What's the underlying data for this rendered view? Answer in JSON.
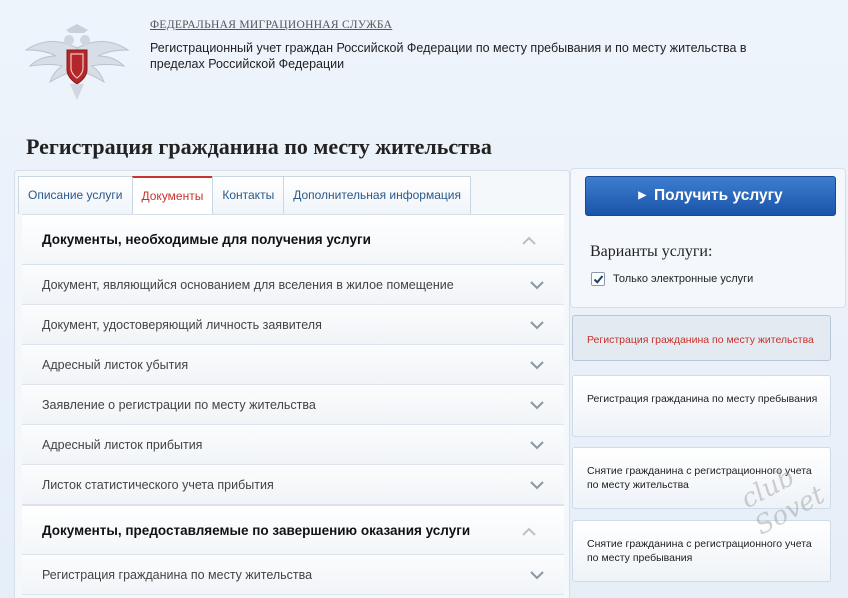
{
  "header": {
    "agency_name": "ФЕДЕРАЛЬНАЯ МИГРАЦИОННАЯ СЛУЖБА",
    "agency_description": "Регистрационный учет граждан Российской Федерации по месту пребывания и по месту жительства в пределах Российской Федерации",
    "emblem_icon": "double-headed-eagle-emblem"
  },
  "page_title": "Регистрация гражданина по месту жительства",
  "tabs": [
    {
      "label": "Описание услуги",
      "active": false
    },
    {
      "label": "Документы",
      "active": true
    },
    {
      "label": "Контакты",
      "active": false
    },
    {
      "label": "Дополнительная информация",
      "active": false
    }
  ],
  "documents": {
    "section1_title": "Документы, необходимые для получения услуги",
    "section1_items": [
      "Документ, являющийся основанием для вселения в жилое помещение",
      "Документ, удостоверяющий личность заявителя",
      "Адресный листок убытия",
      "Заявление о регистрации по месту жительства",
      "Адресный листок прибытия",
      "Листок статистического учета прибытия"
    ],
    "section2_title": "Документы, предоставляемые по завершению оказания услуги",
    "section2_items": [
      "Регистрация гражданина по месту жительства"
    ]
  },
  "sidebar": {
    "get_service_label": "Получить услугу",
    "variants_title": "Варианты услуги:",
    "electronic_only_label": "Только электронные услуги",
    "electronic_only_checked": true,
    "variants": [
      {
        "label": "Регистрация гражданина по месту жительства",
        "selected": true
      },
      {
        "label": "Регистрация гражданина по месту пребывания",
        "selected": false
      },
      {
        "label": "Снятие гражданина с регистрационного учета по месту жительства",
        "selected": false
      },
      {
        "label": "Снятие гражданина с регистрационного учета по месту пребывания",
        "selected": false
      }
    ]
  },
  "watermark": "club Sovet",
  "colors": {
    "accent_red": "#c8332b",
    "button_blue": "#1a54a8",
    "link_blue": "#2a5a8a"
  }
}
